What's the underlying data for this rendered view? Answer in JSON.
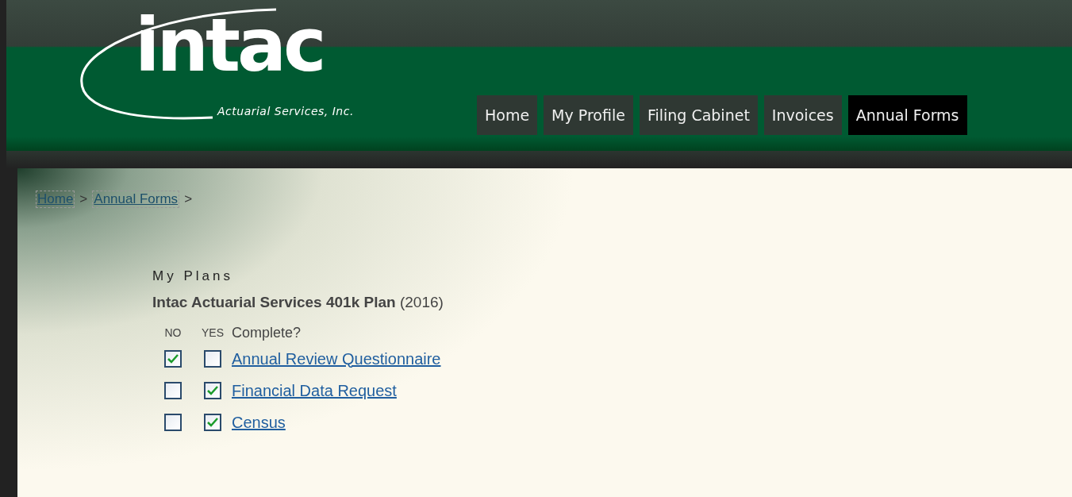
{
  "logo": {
    "name": "intac",
    "tagline": "Actuarial Services, Inc."
  },
  "nav": [
    {
      "label": "Home",
      "selected": false
    },
    {
      "label": "My Profile",
      "selected": false
    },
    {
      "label": "Filing Cabinet",
      "selected": false
    },
    {
      "label": "Invoices",
      "selected": false
    },
    {
      "label": "Annual Forms",
      "selected": true
    }
  ],
  "breadcrumb": [
    {
      "label": "Home"
    },
    {
      "label": "Annual Forms"
    }
  ],
  "breadcrumb_separator": ">",
  "section_title": "My Plans",
  "plan_title": "**Intac Actuarial Services 401k Plan** (2016)",
  "columns": [
    "NO",
    "YES",
    "Complete?"
  ],
  "forms": [
    {
      "no_checked": true,
      "yes_checked": false,
      "label": "Annual Review Questionnaire"
    },
    {
      "no_checked": false,
      "yes_checked": true,
      "label": "Financial Data Request"
    },
    {
      "no_checked": false,
      "yes_checked": true,
      "label": "Census"
    }
  ]
}
